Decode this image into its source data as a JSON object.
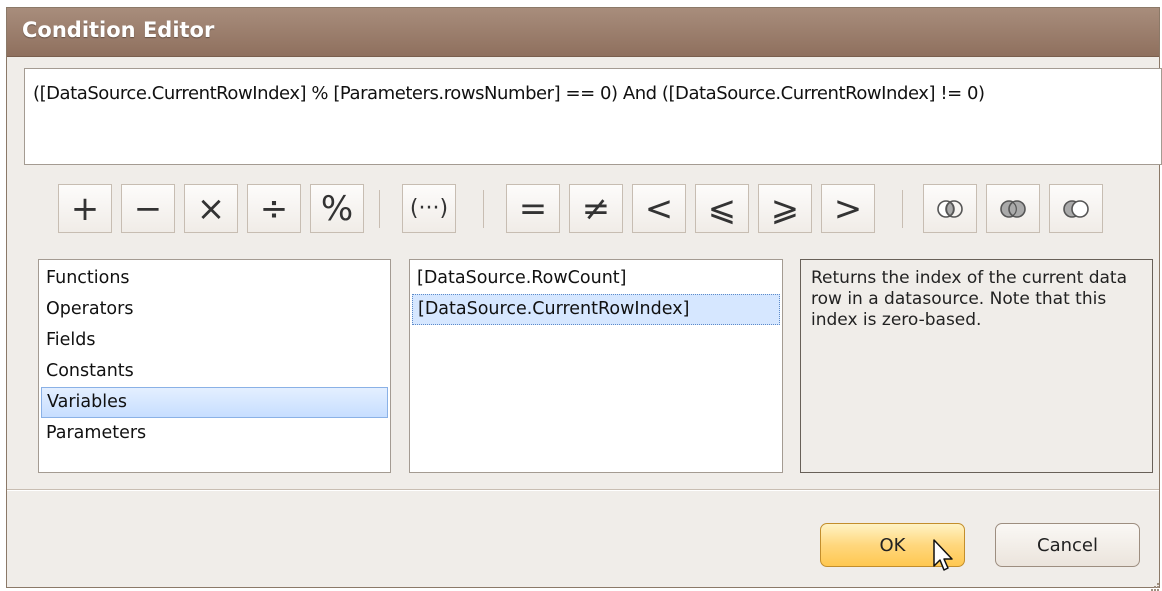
{
  "window": {
    "title": "Condition Editor"
  },
  "expression": {
    "text": "([DataSource.CurrentRowIndex] % [Parameters.rowsNumber] == 0) And ([DataSource.CurrentRowIndex] != 0)"
  },
  "toolbar": {
    "arithmetic": [
      "+",
      "−",
      "×",
      "÷",
      "%"
    ],
    "grouping": "(···)",
    "comparison": [
      "=",
      "≠",
      "<",
      "⩽",
      "⩾",
      ">"
    ],
    "logic_icons": [
      "and-icon",
      "or-icon",
      "not-icon"
    ]
  },
  "categories": {
    "items": [
      "Functions",
      "Operators",
      "Fields",
      "Constants",
      "Variables",
      "Parameters"
    ],
    "selected": "Variables"
  },
  "items": {
    "items": [
      "[DataSource.RowCount]",
      "[DataSource.CurrentRowIndex]"
    ],
    "selected": "[DataSource.CurrentRowIndex]"
  },
  "description": {
    "text": "Returns the index of the current data row in a datasource. Note that this index is zero-based."
  },
  "buttons": {
    "ok": "OK",
    "cancel": "Cancel"
  },
  "colors": {
    "titlebar": "#9a7d6b",
    "ok_button": "#ffd77d",
    "selection": "#c7deff"
  }
}
